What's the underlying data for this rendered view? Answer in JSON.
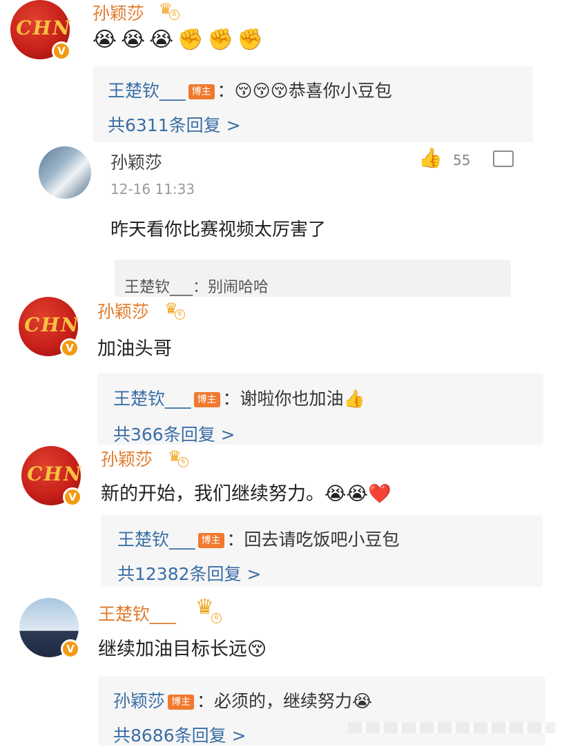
{
  "comments": [
    {
      "user": "孙颖莎",
      "level": "6",
      "avatar_text": "CHN",
      "text_emojis": [
        "😭",
        "😭",
        "😭",
        "✊",
        "✊",
        "✊"
      ],
      "reply": {
        "name": "王楚钦___",
        "tag": "博主",
        "text": "：😚😚😚恭喜你小豆包"
      },
      "more": "共6311条回复 >"
    },
    {
      "user": "孙颖莎",
      "level": "6",
      "avatar_text": "CHN",
      "text": "加油头哥",
      "reply": {
        "name": "王楚钦___",
        "tag": "博主",
        "text": "：谢啦你也加油👍"
      },
      "more": "共366条回复 >"
    },
    {
      "user": "孙颖莎",
      "level": "6",
      "avatar_text": "CHN",
      "text": "新的开始，我们继续努力。😭😭❤️",
      "reply": {
        "name": "王楚钦___",
        "tag": "博主",
        "text": "：回去请吃饭吧小豆包"
      },
      "more": "共12382条回复 >"
    },
    {
      "user": "王楚钦___",
      "level": "6",
      "text": "继续加油目标长远😚",
      "reply": {
        "name": "孙颖莎",
        "tag": "博主",
        "text": "：必须的，继续努力😭"
      },
      "more": "共8686条回复 >"
    }
  ],
  "inner": {
    "user": "孙颖莎",
    "time": "12-16 11:33",
    "likes": "55",
    "text": "昨天看你比赛视频太厉害了",
    "reply": "王楚钦___：别闹哈哈"
  },
  "verified_badge": "V",
  "icons": {
    "like": "thumbs-up-icon",
    "comment": "comment-icon",
    "crown": "crown-icon"
  }
}
